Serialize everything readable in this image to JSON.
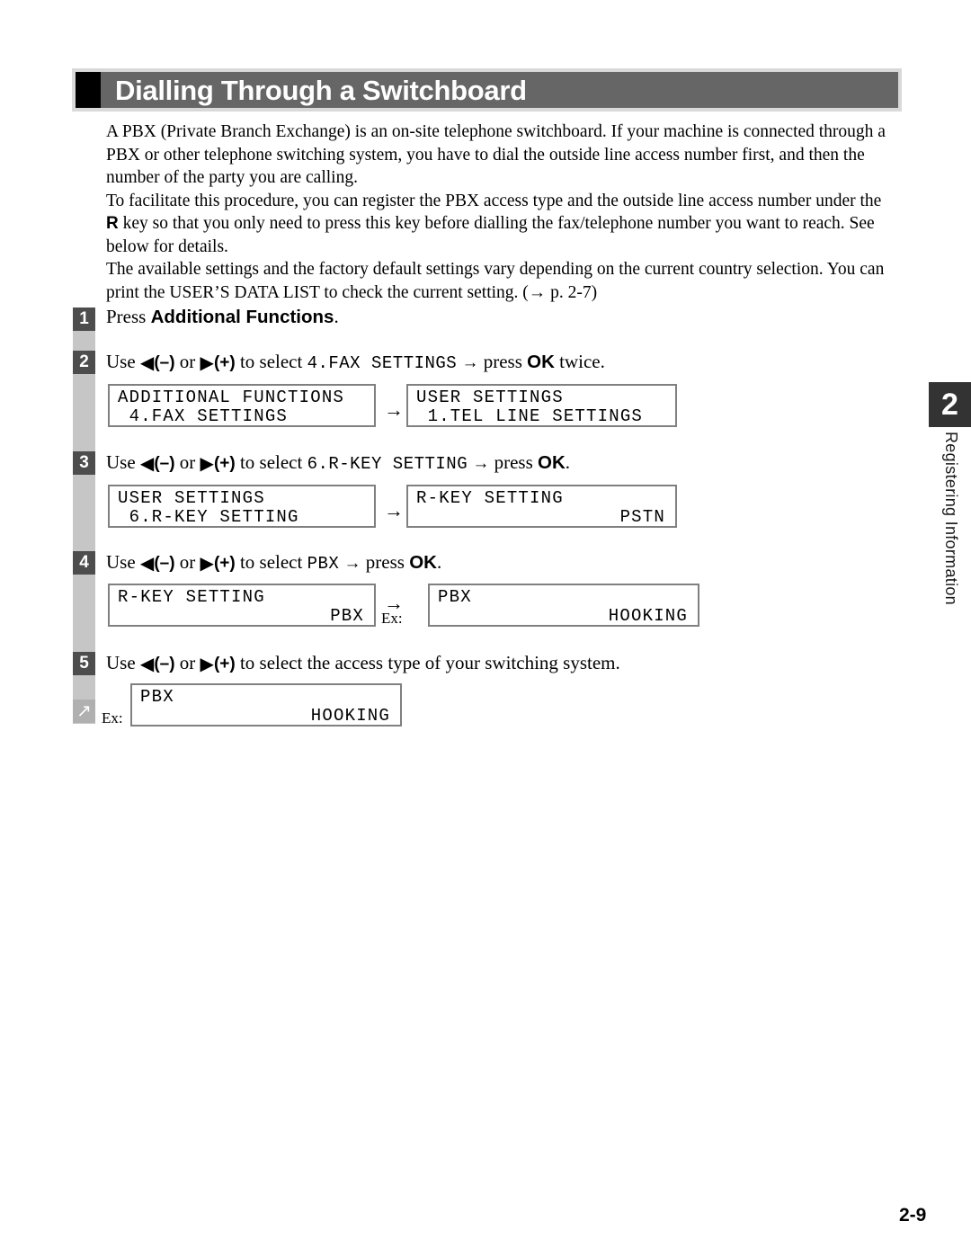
{
  "header": {
    "title": "Dialling Through a Switchboard"
  },
  "intro": {
    "paragraph1": "A PBX (Private Branch Exchange) is an on-site telephone switchboard. If your machine is connected through a PBX or other telephone switching system, you have to dial the outside line access number first, and then the number of the party you are calling.",
    "paragraph2_before": "To facilitate this procedure, you can register the PBX access type and the outside line access number under the ",
    "paragraph2_rkey": "R",
    "paragraph2_after": " key so that you only need to press this key before dialling the fax/telephone number you want to reach. See below for details.",
    "paragraph3": "The available settings and the factory default settings vary depending on the current country selection. You can print the USER’S DATA LIST to check the current setting. (→ p. 2-7)"
  },
  "steps": {
    "s1": {
      "marker": "1",
      "text_before": "Press ",
      "bold": "Additional Functions",
      "text_after": "."
    },
    "s2": {
      "marker": "2",
      "use": "Use",
      "left_tri": "◀",
      "minus": "(–)",
      "or": "or",
      "right_tri": "▶",
      "plus": "(+)",
      "to_select": "to select",
      "value": "4.FAX SETTINGS",
      "arrow": "→",
      "press": "press",
      "ok": "OK",
      "after": "twice."
    },
    "s3": {
      "marker": "3",
      "use": "Use",
      "left_tri": "◀",
      "minus": "(–)",
      "or": "or",
      "right_tri": "▶",
      "plus": "(+)",
      "to_select": "to select",
      "value": "6.R-KEY SETTING",
      "arrow": "→",
      "press": "press",
      "ok": "OK",
      "after": "."
    },
    "s4": {
      "marker": "4",
      "use": "Use",
      "left_tri": "◀",
      "minus": "(–)",
      "or": "or",
      "right_tri": "▶",
      "plus": "(+)",
      "to_select": "to select",
      "value": "PBX",
      "arrow": "→",
      "press": "press",
      "ok": "OK",
      "after": "."
    },
    "s5": {
      "marker": "5",
      "use": "Use",
      "left_tri": "◀",
      "minus": "(–)",
      "or": "or",
      "right_tri": "▶",
      "plus": "(+)",
      "tail": "to select the access type of your switching system."
    },
    "continuation": {
      "marker": "↗"
    }
  },
  "lcds": {
    "step2_left": {
      "line1": "ADDITIONAL FUNCTIONS",
      "line2": " 4.FAX SETTINGS",
      "line2_right": ""
    },
    "step2_right": {
      "line1": "USER SETTINGS",
      "line2": " 1.TEL LINE SETTINGS",
      "line2_right": ""
    },
    "step3_left": {
      "line1": "USER SETTINGS",
      "line2": " 6.R-KEY SETTING",
      "line2_right": ""
    },
    "step3_right": {
      "line1": "R-KEY SETTING",
      "line2": "",
      "line2_right": "PSTN"
    },
    "step4_left": {
      "line1": "R-KEY SETTING",
      "line2": "",
      "line2_right": "PBX"
    },
    "step4_right": {
      "line1": "PBX",
      "line2": "",
      "line2_right": "HOOKING"
    },
    "step5_box": {
      "line1": "PBX",
      "line2": "",
      "line2_right": "HOOKING"
    },
    "transition_arrow": "→",
    "ex_label": "Ex:"
  },
  "side_tab": {
    "chapter_number": "2",
    "chapter_label": "Registering Information"
  },
  "footer": {
    "page_number": "2-9"
  },
  "colors": {
    "header_bar": "#666666",
    "header_frame": "#d9d9d9",
    "rail": "#c6c6c6",
    "marker": "#4d4d4d",
    "marker_arrow": "#b0b0b0",
    "tab": "#333333",
    "lcd_border": "#808080"
  }
}
